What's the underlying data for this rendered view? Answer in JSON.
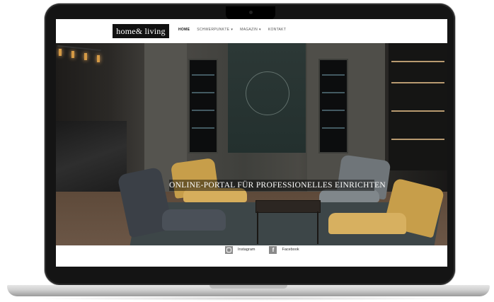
{
  "logo": {
    "text": "home& living"
  },
  "nav": {
    "items": [
      {
        "label": "HOME",
        "active": true,
        "has_dropdown": false
      },
      {
        "label": "SCHWERPUNKTE",
        "active": false,
        "has_dropdown": true
      },
      {
        "label": "MAGAZIN",
        "active": false,
        "has_dropdown": true
      },
      {
        "label": "KONTAKT",
        "active": false,
        "has_dropdown": false
      }
    ]
  },
  "hero": {
    "title": "ONLINE-PORTAL FÜR PROFESSIONELLES EINRICHTEN"
  },
  "social": {
    "instagram": {
      "label": "Instagram",
      "icon": "instagram-icon"
    },
    "facebook": {
      "label": "Facebook",
      "icon": "facebook-icon"
    }
  },
  "colors": {
    "logo_bg": "#111111",
    "accent_chair": "#c79e4a",
    "icon_grey": "#8a8a8a"
  }
}
